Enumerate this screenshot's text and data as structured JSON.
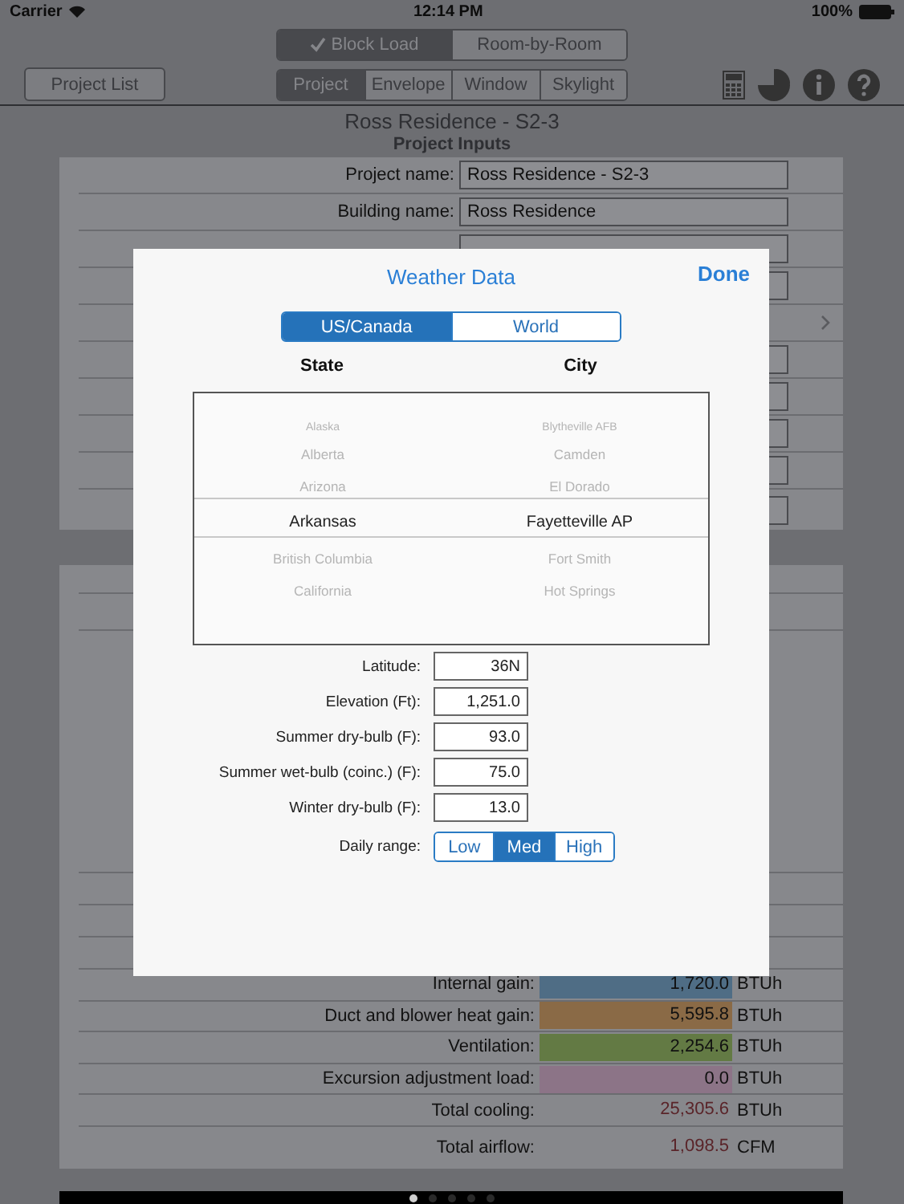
{
  "status_bar": {
    "carrier": "Carrier",
    "time": "12:14 PM",
    "battery": "100%"
  },
  "mode_tabs": [
    {
      "label": "Block Load",
      "selected": true
    },
    {
      "label": "Room-by-Room",
      "selected": false
    }
  ],
  "project_list_button": "Project List",
  "section_tabs": [
    {
      "label": "Project",
      "selected": true
    },
    {
      "label": "Envelope",
      "selected": false
    },
    {
      "label": "Window",
      "selected": false
    },
    {
      "label": "Skylight",
      "selected": false
    }
  ],
  "project_title": "Ross Residence - S2-3",
  "section_title": "Project Inputs",
  "project_inputs": [
    {
      "label": "Project name:",
      "value": "Ross Residence - S2-3"
    },
    {
      "label": "Building name:",
      "value": "Ross Residence"
    }
  ],
  "results": [
    {
      "label": "Internal gain:",
      "value": "1,720.0",
      "unit": "BTUh",
      "color": "#4f6d85",
      "kind": "bar"
    },
    {
      "label": "Duct and blower heat gain:",
      "value": "5,595.8",
      "unit": "BTUh",
      "color": "#8a6a46",
      "kind": "bar"
    },
    {
      "label": "Ventilation:",
      "value": "2,254.6",
      "unit": "BTUh",
      "color": "#637a44",
      "kind": "bar"
    },
    {
      "label": "Excursion adjustment load:",
      "value": "0.0",
      "unit": "BTUh",
      "color": "#8c7487",
      "kind": "bar"
    },
    {
      "label": "Total cooling:",
      "value": "25,305.6",
      "unit": "BTUh",
      "kind": "total"
    },
    {
      "label": "Total airflow:",
      "value": "1,098.5",
      "unit": "CFM",
      "kind": "total"
    }
  ],
  "page_dots": [
    {
      "selected": true
    },
    {
      "selected": false
    },
    {
      "selected": false
    },
    {
      "selected": false
    },
    {
      "selected": false
    }
  ],
  "weather_dialog": {
    "title": "Weather Data",
    "done": "Done",
    "region_tabs": [
      {
        "label": "US/Canada",
        "selected": true
      },
      {
        "label": "World",
        "selected": false
      }
    ],
    "state_header": "State",
    "city_header": "City",
    "states": [
      {
        "label": "Alaska",
        "selected": false
      },
      {
        "label": "Alberta",
        "selected": false
      },
      {
        "label": "Arizona",
        "selected": false
      },
      {
        "label": "Arkansas",
        "selected": true
      },
      {
        "label": "British Columbia",
        "selected": false
      },
      {
        "label": "California",
        "selected": false
      }
    ],
    "cities": [
      {
        "label": "Blytheville AFB",
        "selected": false
      },
      {
        "label": "Camden",
        "selected": false
      },
      {
        "label": "El Dorado",
        "selected": false
      },
      {
        "label": "Fayetteville AP",
        "selected": true
      },
      {
        "label": "Fort Smith",
        "selected": false
      },
      {
        "label": "Hot Springs",
        "selected": false
      }
    ],
    "fields": [
      {
        "label": "Latitude:",
        "value": "36N"
      },
      {
        "label": "Elevation (Ft):",
        "value": "1,251.0"
      },
      {
        "label": "Summer dry-bulb (F):",
        "value": "93.0"
      },
      {
        "label": "Summer wet-bulb (coinc.) (F):",
        "value": "75.0"
      },
      {
        "label": "Winter dry-bulb (F):",
        "value": "13.0"
      }
    ],
    "daily_range_label": "Daily range:",
    "daily_range": [
      {
        "label": "Low",
        "selected": false
      },
      {
        "label": "Med",
        "selected": true
      },
      {
        "label": "High",
        "selected": false
      }
    ]
  }
}
